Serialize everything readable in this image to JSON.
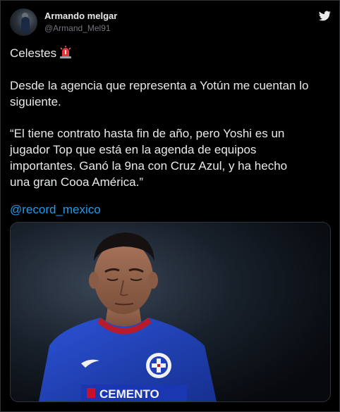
{
  "tweet": {
    "author_name": "Armando melgar",
    "author_handle": "@Armand_Mel91",
    "line1": "Celestes",
    "line2": "Desde la agencia que representa a Yotún me cuentan lo",
    "line3": "siguiente.",
    "quote_line1": "“El tiene contrato hasta fin de año, pero Yoshi es un",
    "quote_line2": "jugador Top que está en la agenda de equipos",
    "quote_line3": "importantes. Ganó la 9na con Cruz Azul, y ha hecho",
    "quote_line4": "una gran Cooa América.”",
    "mention": "@record_mexico",
    "jersey_text": "CEMENTO"
  },
  "colors": {
    "background": "#000000",
    "text": "#e7e9ea",
    "secondary_text": "#71767b",
    "link": "#1d9bf0",
    "jersey_blue": "#1f3fbf"
  },
  "icons": {
    "siren": "siren-emoji-icon",
    "brand": "twitter-bird-icon"
  }
}
